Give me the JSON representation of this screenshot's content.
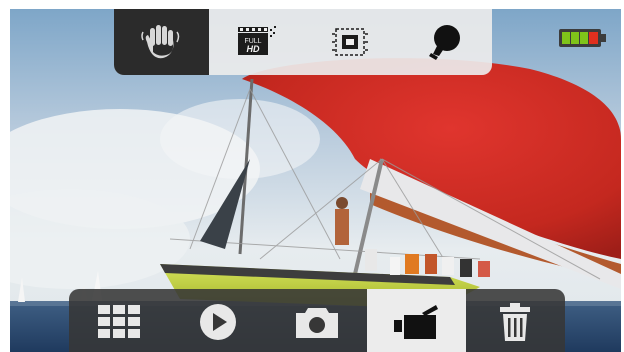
{
  "top_menu": {
    "items": [
      {
        "icon": "hand-wave-icon",
        "active": true
      },
      {
        "icon": "full-hd-video-icon",
        "active": false
      },
      {
        "icon": "image-stabilization-icon",
        "active": false
      },
      {
        "icon": "light-bulb-icon",
        "active": false
      }
    ]
  },
  "battery": {
    "icon": "battery-icon",
    "level": 0.75,
    "colors": {
      "cells": "#7fc41a",
      "low": "#e0301e"
    }
  },
  "bottom_menu": {
    "items": [
      {
        "icon": "gallery-grid-icon",
        "active": false
      },
      {
        "icon": "play-icon",
        "active": false
      },
      {
        "icon": "camera-icon",
        "active": false
      },
      {
        "icon": "video-camera-icon",
        "active": true
      },
      {
        "icon": "trash-icon",
        "active": false
      }
    ]
  },
  "colors": {
    "menu_active_dark": "#2b2b2b",
    "menu_light": "#ececec",
    "menu_dark": "#373737",
    "icon_light": "#e8e8e8"
  }
}
